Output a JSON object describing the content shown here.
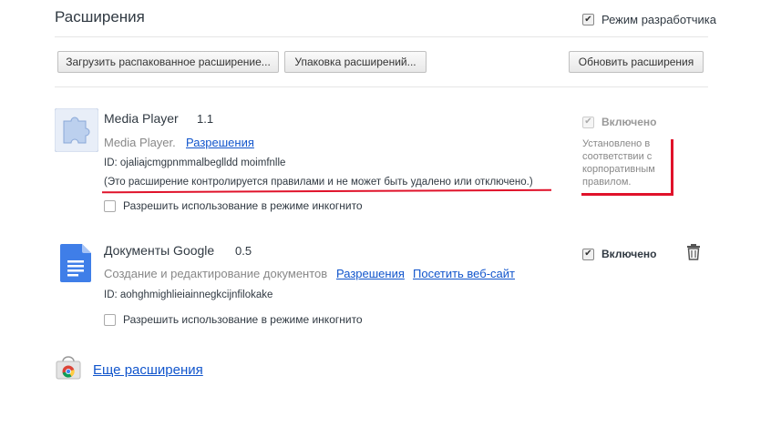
{
  "page": {
    "title": "Расширения",
    "dev_mode_label": "Режим разработчика"
  },
  "toolbar": {
    "load_unpacked": "Загрузить распакованное расширение...",
    "pack": "Упаковка расширений...",
    "update": "Обновить расширения"
  },
  "extensions": [
    {
      "name": "Media Player",
      "version": "1.1",
      "description": "Media Player.",
      "permissions_link": "Разрешения",
      "id_text": "ID: ojaliajcmgpnmmalbeglldd moimfnlle",
      "policy_note": "(Это расширение контролируется правилами и не может быть удалено или отключено.)",
      "incognito_label": "Разрешить использование в режиме инкогнито",
      "enabled_label": "Включено",
      "policy_text": "Установлено в соответствии с корпоративным правилом."
    },
    {
      "name": "Документы Google",
      "version": "0.5",
      "description": "Создание и редактирование документов",
      "permissions_link": "Разрешения",
      "website_link": "Посетить веб-сайт",
      "id_text": "ID: aohghmighlieiainnegkcijnfilokake",
      "incognito_label": "Разрешить использование в режиме инкогнито",
      "enabled_label": "Включено"
    }
  ],
  "footer": {
    "more_extensions": "Еще расширения"
  },
  "icons": [
    "puzzle-icon",
    "google-docs-icon",
    "trash-icon",
    "webstore-icon"
  ],
  "colors": {
    "link": "#1155cc",
    "annotation": "#e0122a"
  }
}
